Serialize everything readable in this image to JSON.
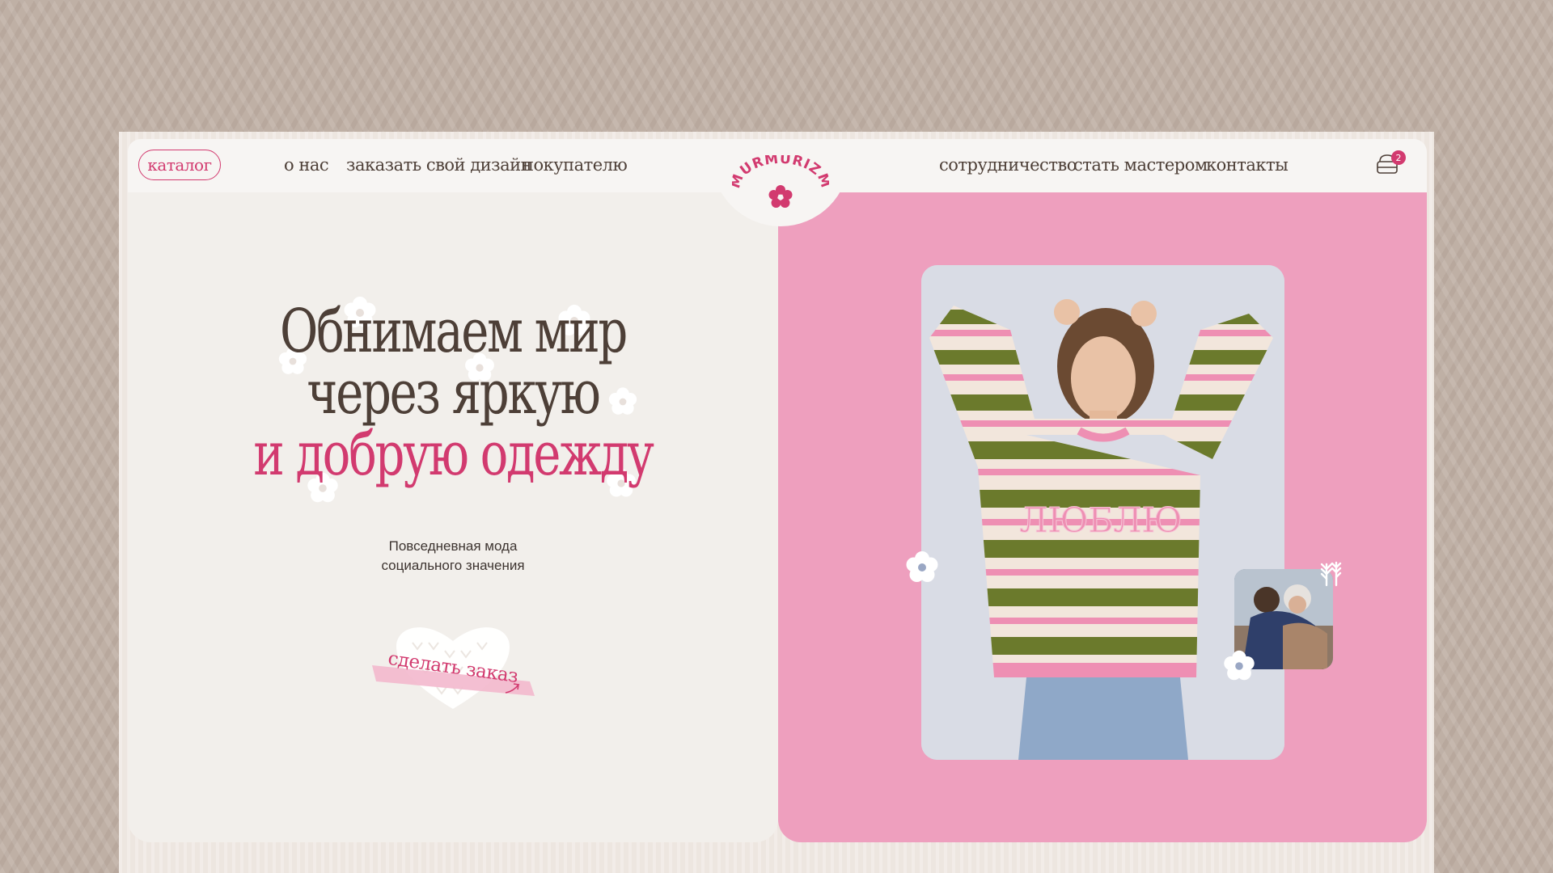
{
  "header": {
    "catalog_label": "каталог",
    "nav_left": [
      "о нас",
      "заказать свой дизайн",
      "покупателю"
    ],
    "nav_right": [
      "сотрудничество",
      "стать мастером",
      "контакты"
    ],
    "logo_text": "MURMURIZM",
    "cart_count": "2"
  },
  "hero": {
    "line1": "Обнимаем мир",
    "line2": "через яркую",
    "line3": "и добрую одежду",
    "subtitle_line1": "Повседневная мода",
    "subtitle_line2": "социального значения",
    "order_button": "сделать заказ"
  },
  "photo": {
    "sweater_text": "ЛЮБЛЮ"
  },
  "colors": {
    "accent": "#d23a6f",
    "pink_panel": "#ee9fbe",
    "left_panel": "#f2efeb",
    "text": "#4d3f37",
    "sweater_green": "#6b7a2c",
    "sweater_pink": "#ee8fb3",
    "sweater_cream": "#f2e6dc"
  },
  "icons": [
    "cart-icon",
    "flower-icon",
    "wheat-icon",
    "arrow-icon"
  ]
}
